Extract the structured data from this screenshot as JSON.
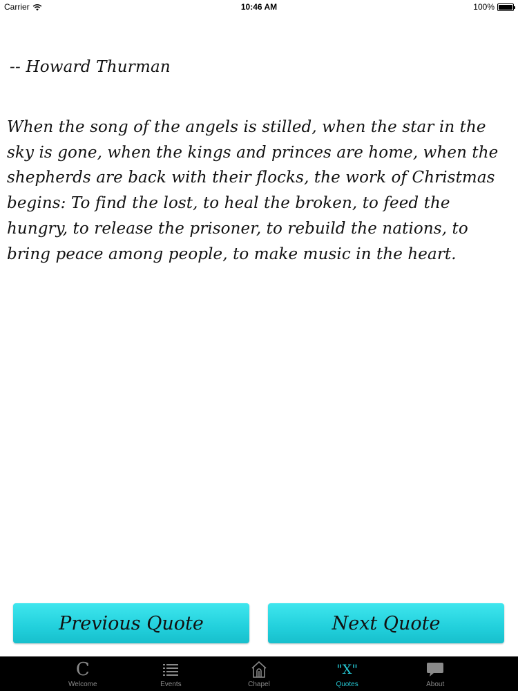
{
  "status_bar": {
    "carrier": "Carrier",
    "time": "10:46 AM",
    "battery": "100%"
  },
  "quote": {
    "author": "-- Howard Thurman",
    "text": "When the song of the angels is stilled, when the star in the sky is gone, when the kings and princes are home, when the shepherds are back with their flocks, the work of Christmas begins: To find the lost, to heal the broken, to feed the hungry, to release the prisoner, to rebuild the nations, to bring peace among people, to make music in the heart."
  },
  "buttons": {
    "previous": "Previous Quote",
    "next": "Next Quote"
  },
  "tab_bar": {
    "active_color": "#25c8d4",
    "inactive_color": "#8a8a8a",
    "items": [
      {
        "label": "Welcome",
        "icon": "C",
        "icon_name": "welcome-c-icon"
      },
      {
        "label": "Events",
        "icon_name": "list-icon"
      },
      {
        "label": "Chapel",
        "icon_name": "chapel-icon"
      },
      {
        "label": "Quotes",
        "icon": "\"X\"",
        "icon_name": "quote-x-icon",
        "active": true
      },
      {
        "label": "About",
        "icon_name": "speech-bubble-icon"
      }
    ]
  }
}
